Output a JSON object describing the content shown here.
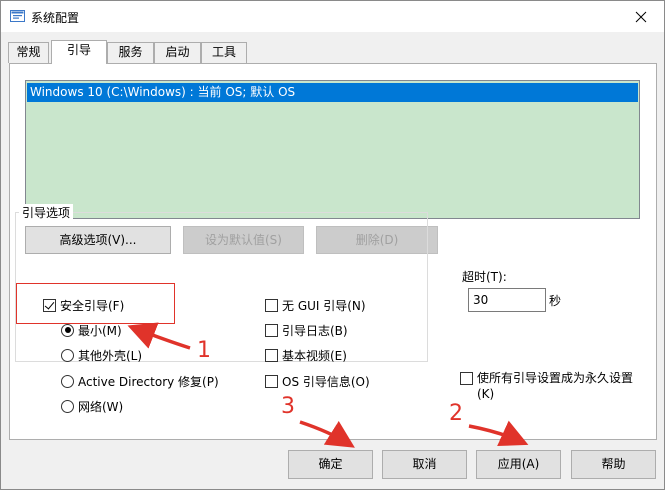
{
  "window": {
    "title": "系统配置"
  },
  "tabs": [
    {
      "label": "常规"
    },
    {
      "label": "引导"
    },
    {
      "label": "服务"
    },
    {
      "label": "启动"
    },
    {
      "label": "工具"
    }
  ],
  "boot_list": {
    "items": [
      "Windows 10 (C:\\Windows) : 当前 OS; 默认 OS"
    ]
  },
  "boot_buttons": {
    "advanced": "高级选项(V)...",
    "set_default": "设为默认值(S)",
    "delete": "删除(D)"
  },
  "boot_options": {
    "group_label": "引导选项",
    "safe_boot": "安全引导(F)",
    "minimal": "最小(M)",
    "alt_shell": "其他外壳(L)",
    "ad_repair": "Active Directory 修复(P)",
    "network": "网络(W)",
    "no_gui": "无 GUI 引导(N)",
    "boot_log": "引导日志(B)",
    "base_video": "基本视频(E)",
    "os_boot_info": "OS 引导信息(O)"
  },
  "timeout": {
    "label": "超时(T):",
    "value": "30",
    "unit": "秒"
  },
  "permanent": {
    "label": "使所有引导设置成为永久设置",
    "key": "(K)"
  },
  "dialog_buttons": {
    "ok": "确定",
    "cancel": "取消",
    "apply": "应用(A)",
    "help": "帮助"
  },
  "annotations": {
    "n1": "1",
    "n2": "2",
    "n3": "3"
  },
  "colors": {
    "accent": "#0078d7",
    "list_bg": "#c9e6cc",
    "annotation": "#e0332a"
  }
}
